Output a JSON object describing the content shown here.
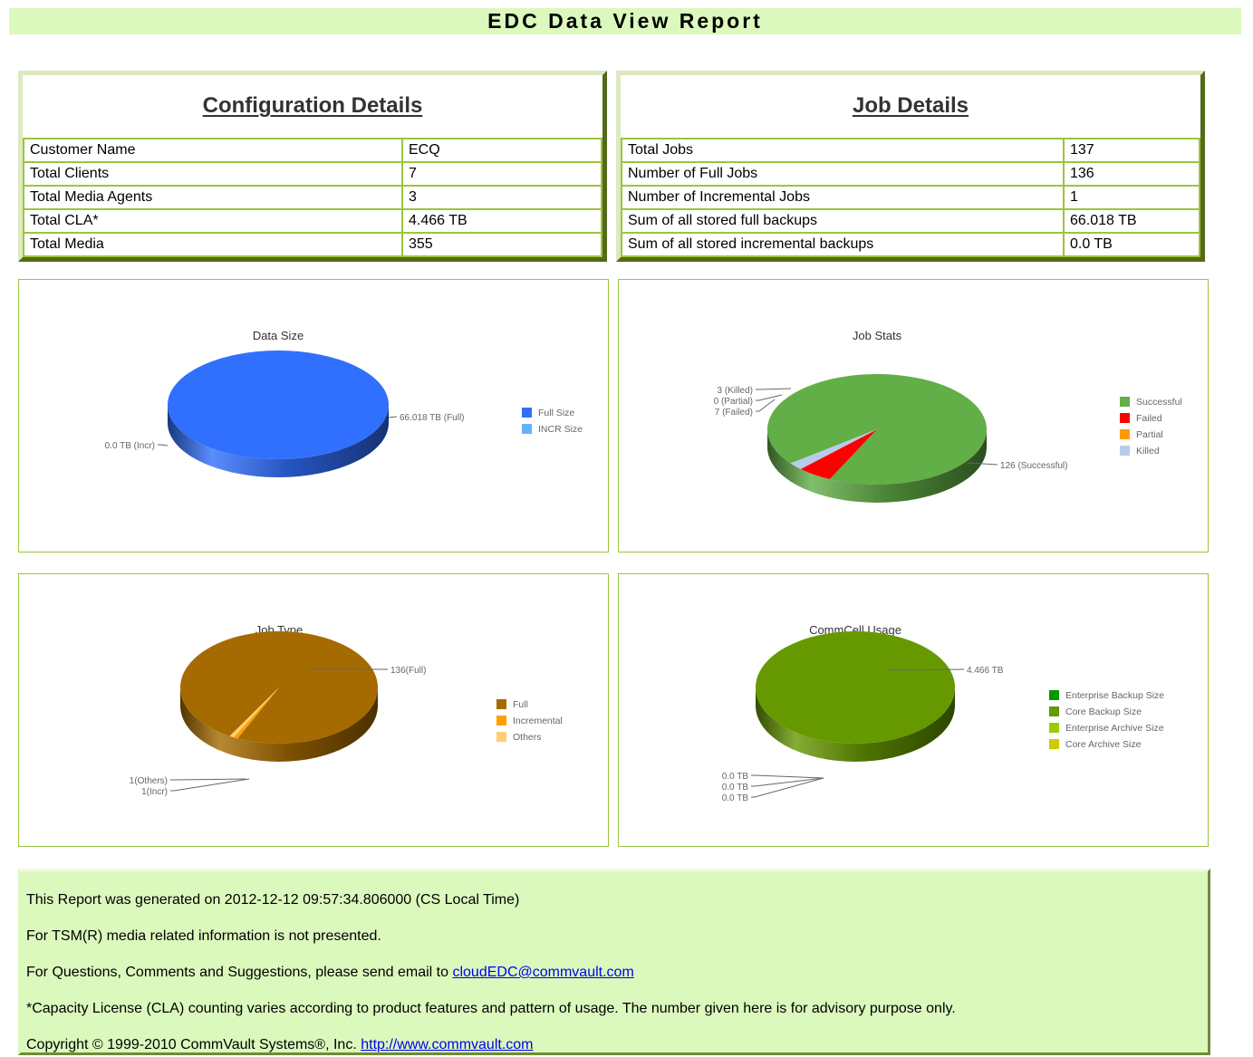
{
  "header": {
    "title": "EDC Data View Report"
  },
  "configuration": {
    "heading": "Configuration Details",
    "rows": [
      {
        "label": "Customer Name",
        "value": "ECQ"
      },
      {
        "label": "Total Clients",
        "value": "7"
      },
      {
        "label": "Total Media Agents",
        "value": "3"
      },
      {
        "label": "Total CLA*",
        "value": "4.466 TB"
      },
      {
        "label": "Total Media",
        "value": "355"
      }
    ]
  },
  "jobs": {
    "heading": "Job Details",
    "rows": [
      {
        "label": "Total Jobs",
        "value": "137"
      },
      {
        "label": "Number of Full Jobs",
        "value": "136"
      },
      {
        "label": "Number of Incremental Jobs",
        "value": "1"
      },
      {
        "label": "Sum of all stored full backups",
        "value": "66.018 TB"
      },
      {
        "label": "Sum of all stored incremental backups",
        "value": "0.0 TB"
      }
    ]
  },
  "chart_data": [
    {
      "type": "pie",
      "title": "Data Size",
      "legend_position": "right",
      "slices": [
        {
          "name": "Full Size",
          "value": 66.018,
          "label": "66.018 TB (Full)",
          "color": "#3170ff"
        },
        {
          "name": "INCR Size",
          "value": 0.0,
          "label": "0.0 TB (Incr)",
          "color": "#63b3ff"
        }
      ]
    },
    {
      "type": "pie",
      "title": "Job Stats",
      "legend_position": "right",
      "slices": [
        {
          "name": "Successful",
          "value": 126,
          "label": "126 (Successful)",
          "color": "#62ae47"
        },
        {
          "name": "Failed",
          "value": 7,
          "label": "7 (Failed)",
          "color": "#ff0000"
        },
        {
          "name": "Partial",
          "value": 0,
          "label": "0 (Partial)",
          "color": "#ff9900"
        },
        {
          "name": "Killed",
          "value": 3,
          "label": "3 (Killed)",
          "color": "#b9cbeb"
        }
      ]
    },
    {
      "type": "pie",
      "title": "Job Type",
      "legend_position": "right",
      "slices": [
        {
          "name": "Full",
          "value": 136,
          "label": "136(Full)",
          "color": "#a66b00"
        },
        {
          "name": "Incremental",
          "value": 1,
          "label": "1(Incr)",
          "color": "#ff9f00"
        },
        {
          "name": "Others",
          "value": 1,
          "label": "1(Others)",
          "color": "#ffcf73"
        }
      ]
    },
    {
      "type": "pie",
      "title": "CommCell Usage",
      "legend_position": "right",
      "slices": [
        {
          "name": "Enterprise Backup Size",
          "value": 0.0,
          "label": "0.0 TB",
          "color": "#009900"
        },
        {
          "name": "Core Backup Size",
          "value": 4.466,
          "label": "4.466 TB",
          "color": "#669900"
        },
        {
          "name": "Enterprise Archive Size",
          "value": 0.0,
          "label": "0.0 TB",
          "color": "#99cc00"
        },
        {
          "name": "Core Archive Size",
          "value": 0.0,
          "label": "0.0 TB",
          "color": "#cccc00"
        }
      ]
    }
  ],
  "footer": {
    "generated": "This Report was generated on 2012-12-12 09:57:34.806000 (CS Local Time)",
    "tsm_note": "For TSM(R) media related information is not presented.",
    "contact_prefix": "For Questions, Comments and Suggestions, please send email to ",
    "contact_email": "cloudEDC@commvault.com",
    "cla_note": "*Capacity License (CLA) counting varies according to product features and pattern of usage. The number given here is for advisory purpose only.",
    "copyright_prefix": "Copyright © 1999-2010 CommVault Systems®, Inc. ",
    "copyright_link": "http://www.commvault.com"
  }
}
